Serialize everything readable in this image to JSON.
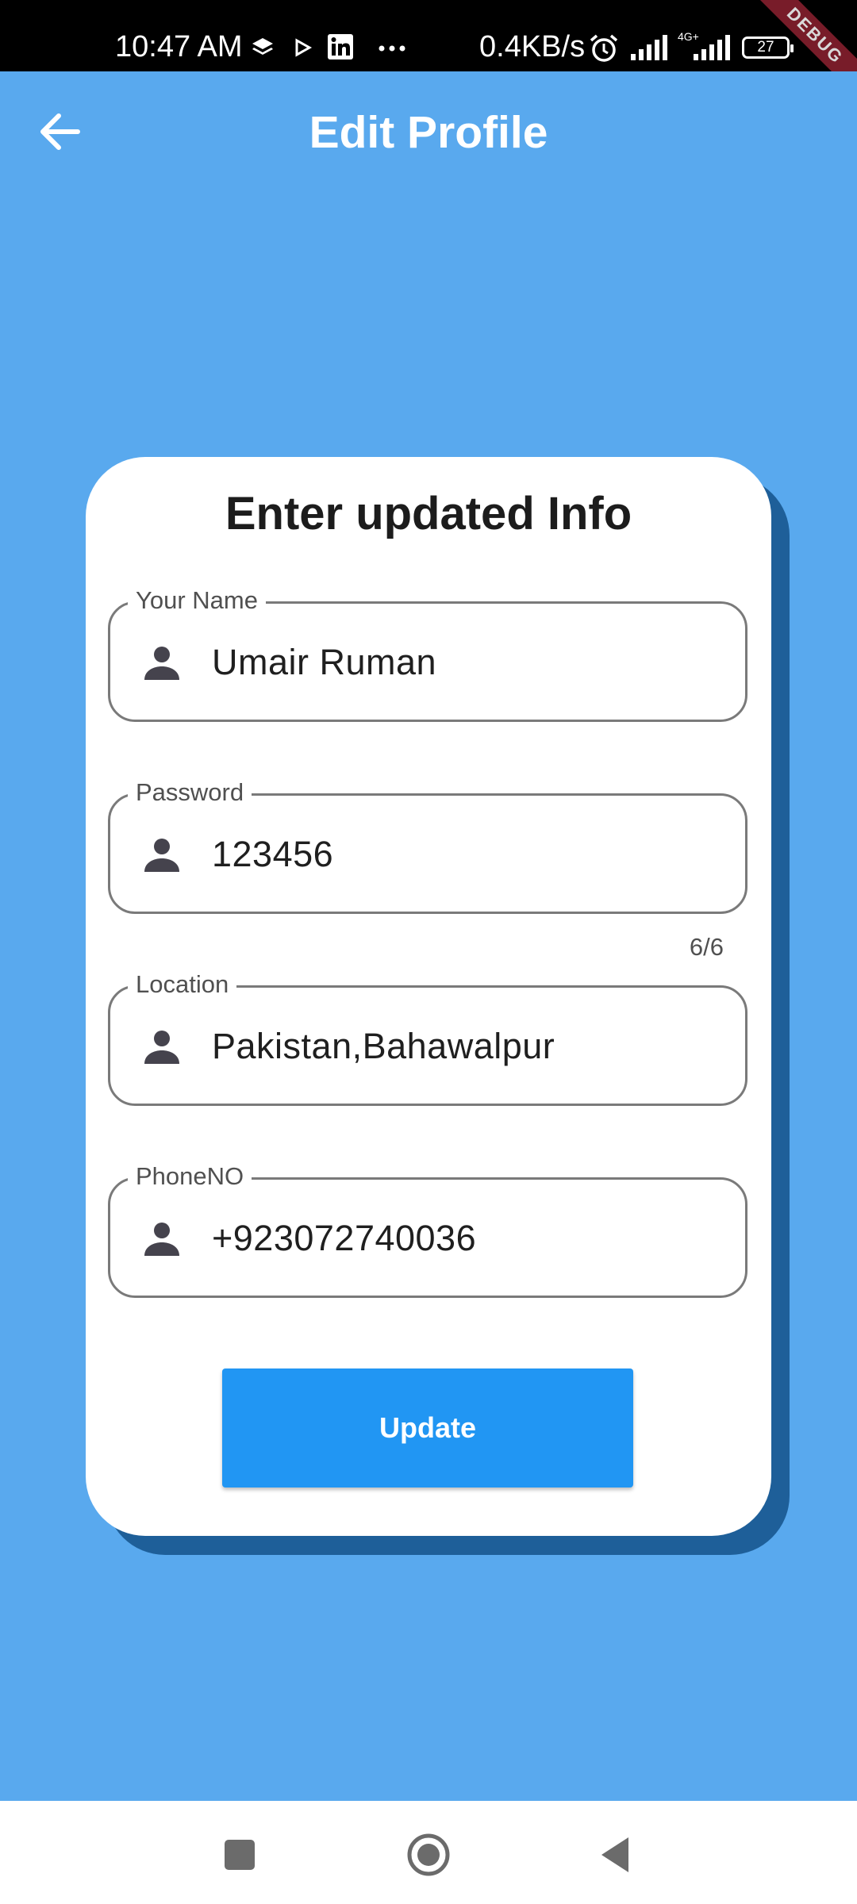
{
  "status_bar": {
    "time": "10:47 AM",
    "net_speed": "0.4KB/s",
    "battery": "27",
    "debug_label": "DEBUG",
    "icons": [
      "layers-icon",
      "play-icon",
      "linkedin-icon",
      "more-icon",
      "alarm-icon",
      "signal-icon",
      "signal-4g-icon",
      "battery-icon"
    ]
  },
  "app_bar": {
    "title": "Edit Profile",
    "back_icon": "arrow-left-icon"
  },
  "card": {
    "title": "Enter updated Info",
    "fields": [
      {
        "label": "Your Name",
        "value": "Umair Ruman",
        "icon": "person-icon"
      },
      {
        "label": "Password",
        "value": "123456",
        "icon": "person-icon",
        "counter": "6/6"
      },
      {
        "label": "Location",
        "value": "Pakistan,Bahawalpur",
        "icon": "person-icon"
      },
      {
        "label": "PhoneNO",
        "value": "+923072740036",
        "icon": "person-icon"
      }
    ],
    "submit_label": "Update"
  },
  "nav_bar": {
    "items": [
      "recents-square-icon",
      "home-circle-icon",
      "back-triangle-icon"
    ]
  },
  "colors": {
    "background": "#59a9ee",
    "card_shadow": "#1e5f99",
    "button": "#2196f3"
  }
}
